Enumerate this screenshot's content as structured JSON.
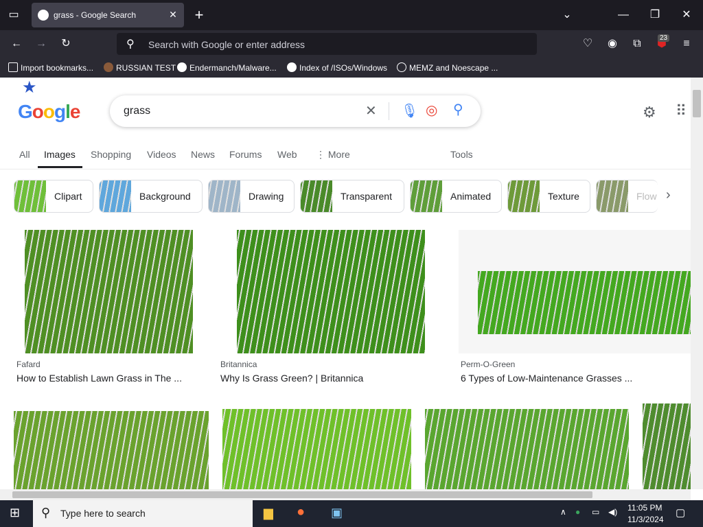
{
  "browser": {
    "tab_title": "grass - Google Search",
    "url_placeholder": "Search with Google or enter address",
    "extensions_badge": "23",
    "bookmarks": [
      {
        "label": "Import bookmarks..."
      },
      {
        "label": "RUSSIAN TEST"
      },
      {
        "label": "Endermanch/Malware..."
      },
      {
        "label": "Index of /ISOs/Windows"
      },
      {
        "label": "MEMZ and Noescape ..."
      }
    ]
  },
  "google": {
    "query": "grass",
    "tabs": [
      "All",
      "Images",
      "Shopping",
      "Videos",
      "News",
      "Forums",
      "Web",
      "More",
      "Tools"
    ],
    "active_tab": "Images",
    "chips": [
      {
        "label": "Clipart",
        "color": "#6fbf3a"
      },
      {
        "label": "Background",
        "color": "#5fa7dc"
      },
      {
        "label": "Drawing",
        "color": "#9fb5c8"
      },
      {
        "label": "Transparent",
        "color": "#4a8a2a"
      },
      {
        "label": "Animated",
        "color": "#5f9e3a"
      },
      {
        "label": "Texture",
        "color": "#6e9a3a"
      },
      {
        "label": "Flow",
        "color": "#8a9a6a"
      }
    ],
    "results_row1": [
      {
        "source": "Fafard",
        "caption": "How to Establish Lawn Grass in The ...",
        "color": "#4f8f24"
      },
      {
        "source": "Britannica",
        "caption": "Why Is Grass Green? | Britannica",
        "color": "#3e8f1c"
      },
      {
        "source": "Perm-O-Green",
        "caption": "6 Types of Low-Maintenance Grasses ...",
        "color": "#44a820"
      }
    ],
    "results_row2_colors": [
      "#6aa22e",
      "#6fc02a",
      "#5aa630",
      "#4f8c2f"
    ]
  },
  "taskbar": {
    "search_placeholder": "Type here to search",
    "time": "11:05 PM",
    "date": "11/3/2024"
  }
}
